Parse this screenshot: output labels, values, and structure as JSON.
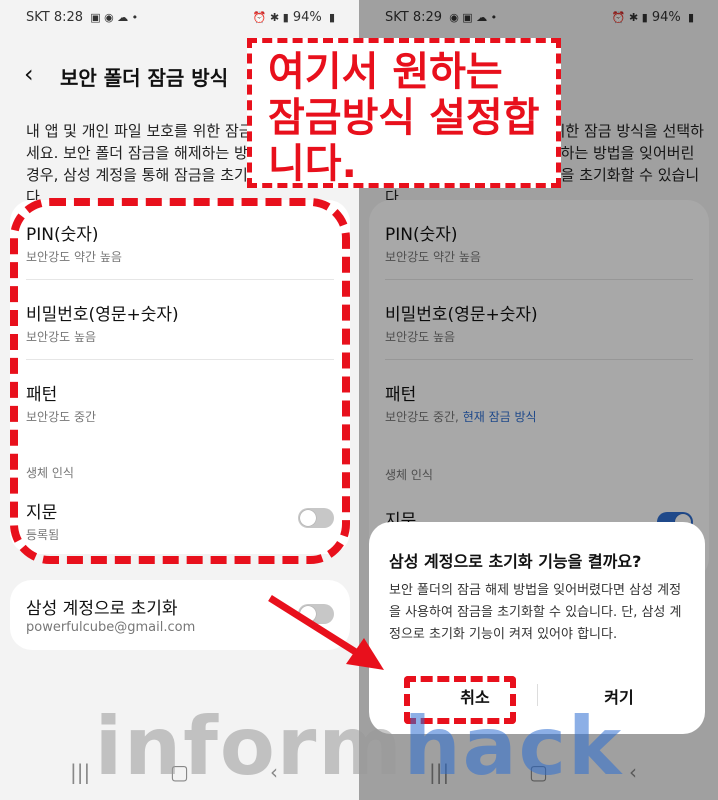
{
  "left": {
    "status": {
      "carrier": "SKT",
      "time": "8:28",
      "battery": "94%"
    },
    "title": "보안 폴더 잠금 방식",
    "description": "내 앱 및 개인 파일 보호를 위한 잠금 방식을 선택하세요. 보안 폴더 잠금을 해제하는 방법을 잊어버린 경우, 삼성 계정을 통해 잠금을 초기화할 수 있습니다.",
    "items": [
      {
        "title": "PIN(숫자)",
        "subtitle": "보안강도 약간 높음"
      },
      {
        "title": "비밀번호(영문+숫자)",
        "subtitle": "보안강도 높음"
      },
      {
        "title": "패턴",
        "subtitle": "보안강도 중간"
      }
    ],
    "biometric_header": "생체 인식",
    "fingerprint": {
      "title": "지문",
      "subtitle": "등록됨",
      "toggle_on": false
    },
    "reset": {
      "title": "삼성 계정으로 초기화",
      "subtitle": "powerfulcube@gmail.com",
      "toggle_on": false
    }
  },
  "right": {
    "status": {
      "carrier": "SKT",
      "time": "8:29",
      "battery": "94%"
    },
    "description": "내 앱 및 개인 파일 보호를 위한 잠금 방식을 선택하세요. 보안 폴더 잠금을 해제하는 방법을 잊어버린 경우, 삼성 계정을 통해 잠금을 초기화할 수 있습니다.",
    "items": [
      {
        "title": "PIN(숫자)",
        "subtitle": "보안강도 약간 높음"
      },
      {
        "title": "비밀번호(영문+숫자)",
        "subtitle": "보안강도 높음"
      },
      {
        "title": "패턴",
        "subtitle": "보안강도 중간, ",
        "current": "현재 잠금 방식"
      }
    ],
    "biometric_header": "생체 인식",
    "fingerprint": {
      "title": "지문",
      "toggle_on": true
    },
    "dialog": {
      "title": "삼성 계정으로 초기화 기능을 켤까요?",
      "body": "보안 폴더의 잠금 해제 방법을 잊어버렸다면 삼성 계정을 사용하여 잠금을 초기화할 수 있습니다. 단, 삼성 계정으로 초기화 기능이 켜져 있어야 합니다.",
      "cancel": "취소",
      "confirm": "켜기"
    }
  },
  "annotation": {
    "callout": "여기서 원하는\n잠금방식 설정합\n니다."
  },
  "watermark": {
    "part1": "inform",
    "part2": "hack"
  },
  "icons": [
    "back-arrow-icon",
    "recent-apps-icon",
    "home-icon",
    "nav-back-icon"
  ],
  "colors": {
    "accent": "#2f6fd2",
    "annotation_red": "#e8101c"
  }
}
